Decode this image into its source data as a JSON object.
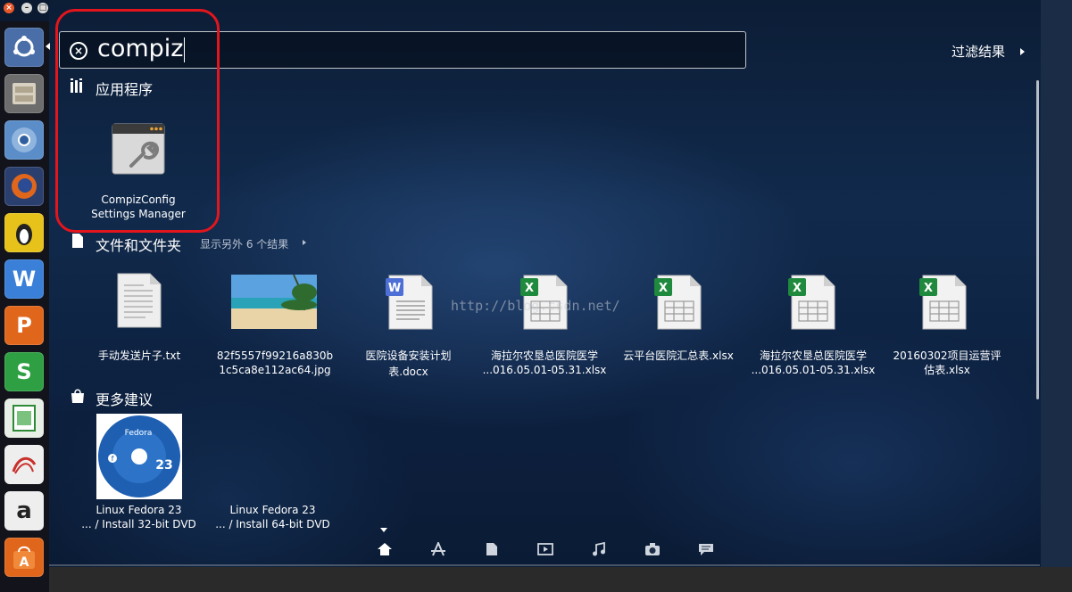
{
  "window_controls": {
    "close": "×",
    "minimize": "–",
    "maximize": "□"
  },
  "launcher": {
    "items": [
      {
        "name": "ubuntu-dash",
        "color": "#4a6fa8"
      },
      {
        "name": "files",
        "color": "#7a7a7a"
      },
      {
        "name": "chromium",
        "color": "#5b8ec9"
      },
      {
        "name": "firefox",
        "color": "#e0661c"
      },
      {
        "name": "terminal-penguin",
        "color": "#e7c21a"
      },
      {
        "name": "wps-writer",
        "color": "#3a7fd8"
      },
      {
        "name": "wps-presentation",
        "color": "#e0661c"
      },
      {
        "name": "wps-spreadsheets",
        "color": "#2ea043"
      },
      {
        "name": "libreoffice-calc",
        "color": "#2e8a36"
      },
      {
        "name": "pdf-reader",
        "color": "#c9302c"
      },
      {
        "name": "amazon",
        "color": "#e6e6e6"
      },
      {
        "name": "software-center",
        "color": "#e0661c"
      }
    ]
  },
  "search": {
    "query": "compiz"
  },
  "filter_label": "过滤结果",
  "sections": {
    "apps": {
      "title": "应用程序",
      "items": [
        {
          "label_line1": "CompizConfig",
          "label_line2": "Settings Manager"
        }
      ]
    },
    "files": {
      "title": "文件和文件夹",
      "more": "显示另外 6 个结果",
      "items": [
        {
          "line1": "手动发送片子.txt",
          "line2": ""
        },
        {
          "line1": "82f5557f99216a830b",
          "line2": "1c5ca8e112ac64.jpg"
        },
        {
          "line1": "医院设备安装计划",
          "line2": "表.docx"
        },
        {
          "line1": "海拉尔农垦总医院医学",
          "line2": "...016.05.01-05.31.xlsx"
        },
        {
          "line1": "云平台医院汇总表.xlsx",
          "line2": ""
        },
        {
          "line1": "海拉尔农垦总医院医学",
          "line2": "...016.05.01-05.31.xlsx"
        },
        {
          "line1": "20160302项目运营评",
          "line2": "估表.xlsx"
        }
      ]
    },
    "suggestions": {
      "title": "更多建议",
      "items": [
        {
          "line1": "Linux Fedora 23",
          "line2": "... / Install 32-bit DVD"
        },
        {
          "line1": "Linux Fedora 23",
          "line2": "... / Install 64-bit DVD"
        }
      ],
      "disc": {
        "brand": "Fedora",
        "version": "23"
      }
    }
  },
  "watermark": "http://blog.csdn.net/",
  "lenses": [
    "home",
    "applications",
    "files",
    "video",
    "music",
    "photos",
    "social"
  ]
}
